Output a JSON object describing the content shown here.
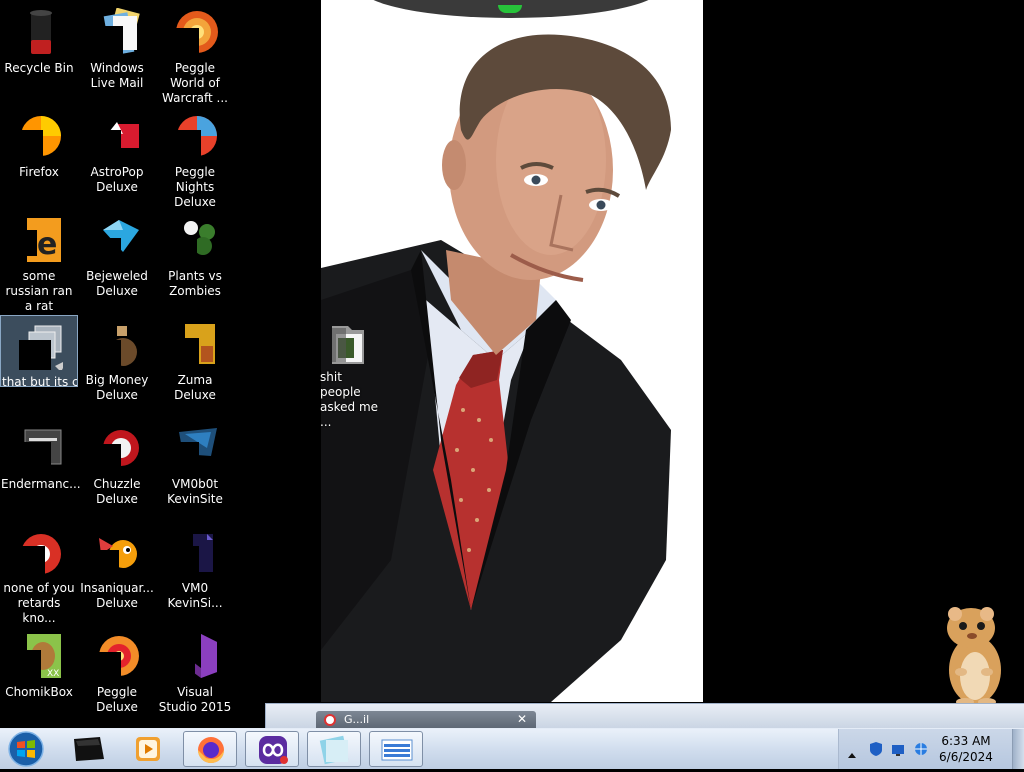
{
  "desktop": {
    "icons": [
      {
        "id": "recycle-bin",
        "label": "Recycle Bin",
        "icon": "trash-bin-icon"
      },
      {
        "id": "windows-live-mail",
        "label": "Windows Live Mail",
        "icon": "mail-icon"
      },
      {
        "id": "peggle-world-of-warcraft",
        "label": "Peggle World of Warcraft ...",
        "icon": "peggle-icon"
      },
      {
        "id": "firefox",
        "label": "Firefox",
        "icon": "firefox-icon"
      },
      {
        "id": "astropop-deluxe",
        "label": "AstroPop Deluxe",
        "icon": "astropop-icon"
      },
      {
        "id": "peggle-nights-deluxe",
        "label": "Peggle Nights Deluxe",
        "icon": "peggle-nights-icon"
      },
      {
        "id": "some-russian-ran-a-rat",
        "label": "some russian ran a rat",
        "icon": "document-icon"
      },
      {
        "id": "bejeweled-deluxe",
        "label": "Bejeweled Deluxe",
        "icon": "gem-icon"
      },
      {
        "id": "plants-vs-zombies",
        "label": "Plants vs Zombies",
        "icon": "plant-icon"
      },
      {
        "id": "that-but-its-c",
        "label": "that but its c",
        "icon": "shortcut-icon"
      },
      {
        "id": "big-money-deluxe",
        "label": "Big Money Deluxe",
        "icon": "money-bag-icon"
      },
      {
        "id": "zuma-deluxe",
        "label": "Zuma Deluxe",
        "icon": "zuma-icon"
      },
      {
        "id": "endermanch",
        "label": "Endermanc...",
        "icon": "window-app-icon"
      },
      {
        "id": "chuzzle-deluxe",
        "label": "Chuzzle Deluxe",
        "icon": "chuzzle-icon"
      },
      {
        "id": "vm0b0t-kevinsite",
        "label": "VM0b0t KevinSite",
        "icon": "vm-icon"
      },
      {
        "id": "none-of-you",
        "label": "none of you retards kno...",
        "icon": "chrome-icon"
      },
      {
        "id": "insaniquarium-deluxe",
        "label": "Insaniquar... Deluxe",
        "icon": "fish-icon"
      },
      {
        "id": "vm0-kevinsi",
        "label": "VM0 KevinSi...",
        "icon": "vm-doc-icon"
      },
      {
        "id": "chomikbox",
        "label": "ChomikBox",
        "icon": "hamster-box-icon"
      },
      {
        "id": "peggle-deluxe",
        "label": "Peggle Deluxe",
        "icon": "peggle-deluxe-icon"
      },
      {
        "id": "visual-studio-2015",
        "label": "Visual Studio 2015",
        "icon": "visual-studio-icon"
      }
    ],
    "folder": {
      "label": "shit people asked me ...",
      "icon": "folder-icon"
    }
  },
  "window": {
    "tab_title": "G...il",
    "close_glyph": "✕"
  },
  "taskbar": {
    "start": "windows-orb-icon",
    "pinned": [
      {
        "name": "terminal",
        "icon": "terminal-icon"
      },
      {
        "name": "media-player",
        "icon": "media-player-icon"
      },
      {
        "name": "firefox",
        "icon": "firefox-icon"
      },
      {
        "name": "app",
        "icon": "infinity-app-icon"
      },
      {
        "name": "notes",
        "icon": "notes-icon"
      },
      {
        "name": "keyboard",
        "icon": "keyboard-icon"
      }
    ],
    "tray": {
      "time": "6:33 AM",
      "date": "6/6/2024"
    }
  },
  "colors": {
    "taskbar": "#cfdced",
    "desktop": "#000000",
    "accent": "#1b7fd8"
  }
}
